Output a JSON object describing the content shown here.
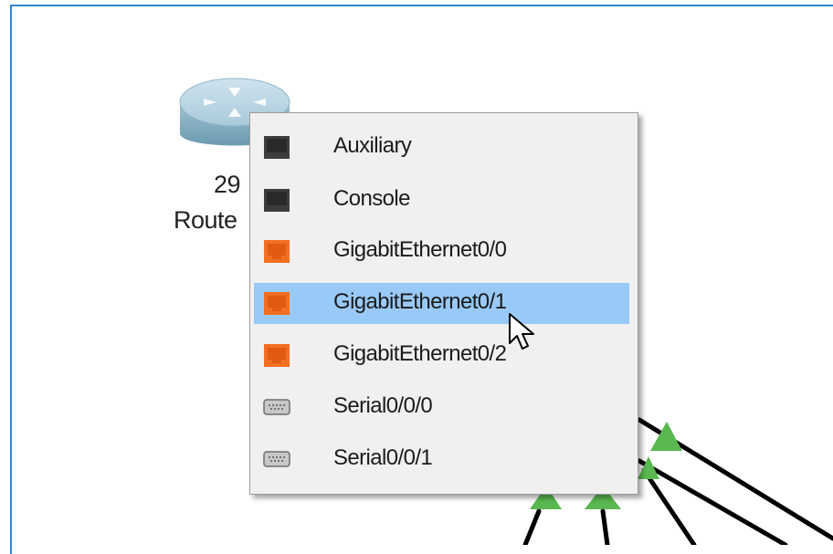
{
  "topology": {
    "device": {
      "model": "29",
      "name": "Route",
      "icon": "router-icon"
    }
  },
  "port_menu": {
    "items": [
      {
        "label": "Auxiliary",
        "port_type": "console-port",
        "color": "#3d3d3d",
        "selected": false
      },
      {
        "label": "Console",
        "port_type": "console-port",
        "color": "#3d3d3d",
        "selected": false
      },
      {
        "label": "GigabitEthernet0/0",
        "port_type": "ethernet-port",
        "color": "#f26f22",
        "selected": false
      },
      {
        "label": "GigabitEthernet0/1",
        "port_type": "ethernet-port",
        "color": "#f26f22",
        "selected": true
      },
      {
        "label": "GigabitEthernet0/2",
        "port_type": "ethernet-port",
        "color": "#f26f22",
        "selected": false
      },
      {
        "label": "Serial0/0/0",
        "port_type": "serial-port",
        "color": "#b9b9b9",
        "selected": false
      },
      {
        "label": "Serial0/0/1",
        "port_type": "serial-port",
        "color": "#b9b9b9",
        "selected": false
      }
    ],
    "highlight_color": "#99c9f6"
  },
  "link_status_color": "#5cb85c",
  "canvas_border_color": "#2f86d6"
}
